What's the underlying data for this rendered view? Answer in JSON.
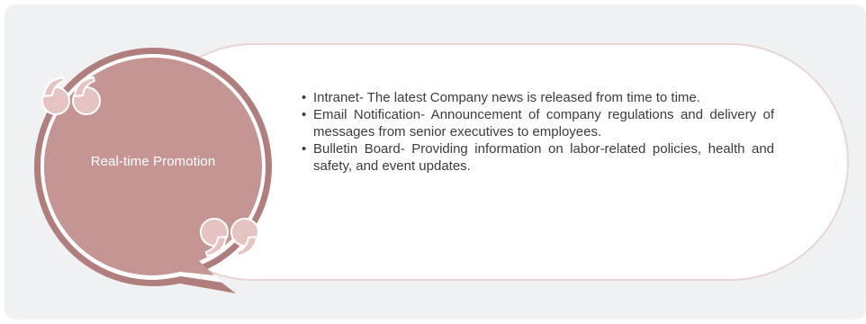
{
  "bubble": {
    "title": "Real-time Promotion"
  },
  "items": [
    {
      "bullet": "•",
      "text": "Intranet- The latest Company news is released from time to time."
    },
    {
      "bullet": "•",
      "text": "Email Notification- Announcement of company regulations and delivery of messages from senior executives to employees."
    },
    {
      "bullet": "•",
      "text": "Bulletin Board- Providing information on labor-related policies, health and safety, and event updates."
    }
  ],
  "colors": {
    "panel": "#f0f1f3",
    "bubble_fill": "#c59593",
    "bubble_ring": "#b07f7d",
    "quote_marks": "#e4c3c0",
    "capsule_border": "#e8d6d4",
    "text": "#3c3c3c"
  },
  "icons": {
    "open_quote": "open-quote-icon",
    "close_quote": "close-quote-icon"
  }
}
